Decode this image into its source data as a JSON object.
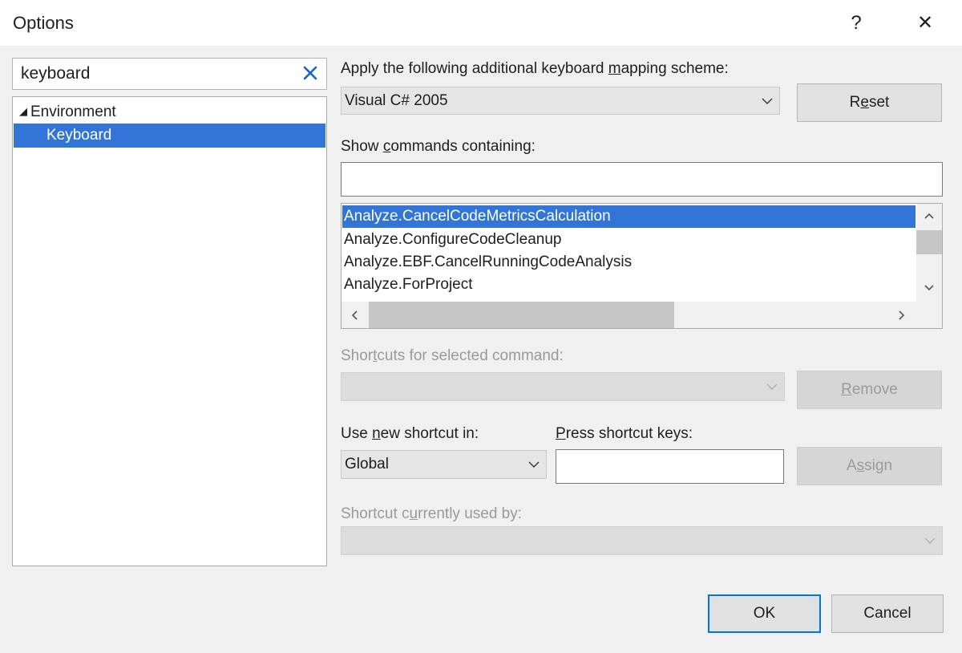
{
  "window": {
    "title": "Options",
    "help_glyph": "?",
    "close_glyph": "✕"
  },
  "search": {
    "value": "keyboard"
  },
  "tree": {
    "items": [
      {
        "label": "Environment",
        "expanded": true
      },
      {
        "label": "Keyboard",
        "selected": true
      }
    ]
  },
  "mapping": {
    "label_pre": "Apply the following additional keyboard ",
    "label_u": "m",
    "label_post": "apping scheme:",
    "value": "Visual C# 2005",
    "reset_pre": "R",
    "reset_u": "e",
    "reset_post": "set"
  },
  "commands": {
    "label_pre": "Show ",
    "label_u": "c",
    "label_post": "ommands containing:",
    "filter_value": "",
    "items": [
      "Analyze.CancelCodeMetricsCalculation",
      "Analyze.ConfigureCodeCleanup",
      "Analyze.EBF.CancelRunningCodeAnalysis",
      "Analyze.ForProject"
    ],
    "selected_index": 0
  },
  "shortcuts": {
    "label_pre": "Shor",
    "label_u": "t",
    "label_post": "cuts for selected command:",
    "remove_u": "R",
    "remove_post": "emove"
  },
  "new_shortcut": {
    "label_pre": "Use ",
    "label_u": "n",
    "label_post": "ew shortcut in:",
    "value": "Global"
  },
  "press_keys": {
    "label_u": "P",
    "label_post": "ress shortcut keys:",
    "value": "",
    "assign_pre": "A",
    "assign_u": "s",
    "assign_post": "sign"
  },
  "currently_used": {
    "label_pre": "Shortcut c",
    "label_u": "u",
    "label_post": "rrently used by:"
  },
  "footer": {
    "ok_label": "OK",
    "cancel_label": "Cancel"
  },
  "colors": {
    "accent": "#3375d6",
    "default_button_border": "#0078d7",
    "disabled_text": "#9a9a9a"
  }
}
